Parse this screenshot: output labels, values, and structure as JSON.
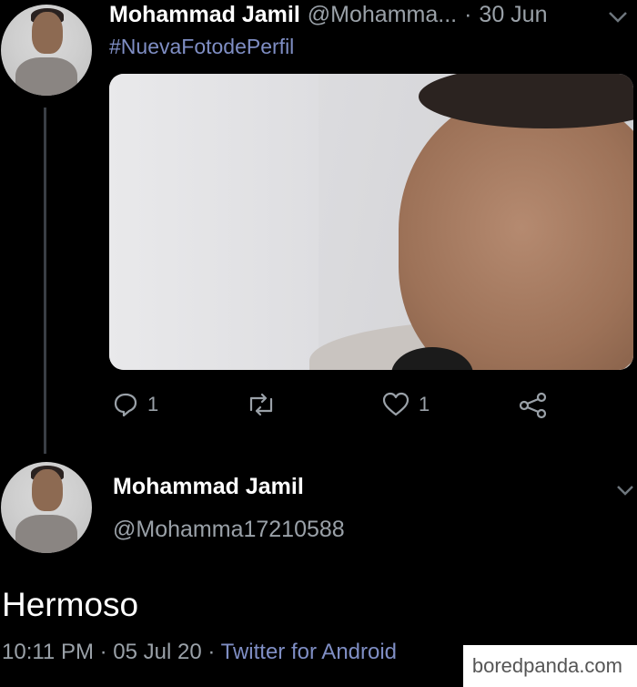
{
  "tweet": {
    "author_name": "Mohammad Jamil",
    "author_handle": "@Mohamma...",
    "separator": "·",
    "date": "30 Jun",
    "hashtag": "#NuevaFotodePerfil",
    "actions": {
      "reply_count": "1",
      "like_count": "1"
    }
  },
  "reply": {
    "author_name": "Mohammad Jamil",
    "author_handle": "@Mohamma17210588",
    "text": "Hermoso",
    "time": "10:11 PM",
    "date": "05 Jul 20",
    "separator": "·",
    "source": "Twitter for Android"
  },
  "watermark": "boredpanda.com",
  "icons": {
    "reply": "reply-icon",
    "retweet": "retweet-icon",
    "like": "heart-icon",
    "share": "share-icon",
    "menu": "chevron-down-icon"
  },
  "colors": {
    "background": "#000000",
    "link": "#7f8ec4",
    "muted": "#9aa1a8"
  }
}
